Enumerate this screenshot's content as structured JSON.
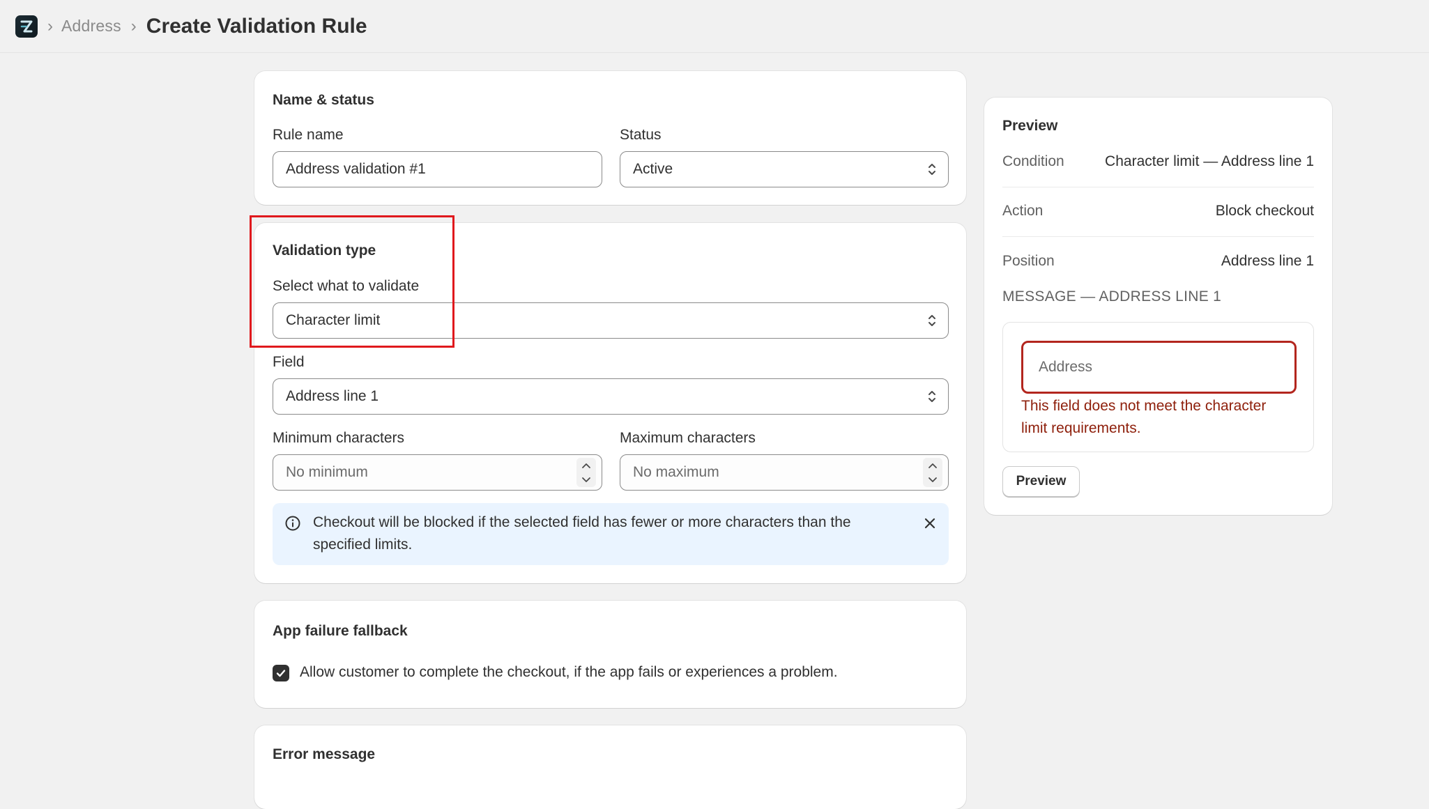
{
  "header": {
    "breadcrumb_parent": "Address",
    "page_title": "Create Validation Rule"
  },
  "name_status": {
    "title": "Name & status",
    "rule_name_label": "Rule name",
    "rule_name_value": "Address validation #1",
    "status_label": "Status",
    "status_value": "Active"
  },
  "validation": {
    "title": "Validation type",
    "select_label": "Select what to validate",
    "select_value": "Character limit",
    "field_label": "Field",
    "field_value": "Address line 1",
    "min_label": "Minimum characters",
    "min_placeholder": "No minimum",
    "max_label": "Maximum characters",
    "max_placeholder": "No maximum",
    "banner_line1": "Checkout will be blocked if the selected field has fewer or more characters than the",
    "banner_line2": "specified limits."
  },
  "fallback": {
    "title": "App failure fallback",
    "checkbox_label": "Allow customer to complete the checkout, if the app fails or experiences a problem.",
    "checked": true
  },
  "error_message": {
    "title": "Error message"
  },
  "preview": {
    "title": "Preview",
    "condition_key": "Condition",
    "condition_val": "Character limit — Address line 1",
    "action_key": "Action",
    "action_val": "Block checkout",
    "position_key": "Position",
    "position_val": "Address line 1",
    "message_heading": "MESSAGE — ADDRESS LINE 1",
    "input_placeholder": "Address",
    "error_line1": "This field does not meet the character",
    "error_line2": "limit requirements.",
    "button_label": "Preview"
  },
  "colors": {
    "background": "#f1f1f1",
    "card": "#ffffff",
    "highlight": "#e0191d",
    "error": "#8e1f0b",
    "info_banner": "#eaf4ff"
  }
}
